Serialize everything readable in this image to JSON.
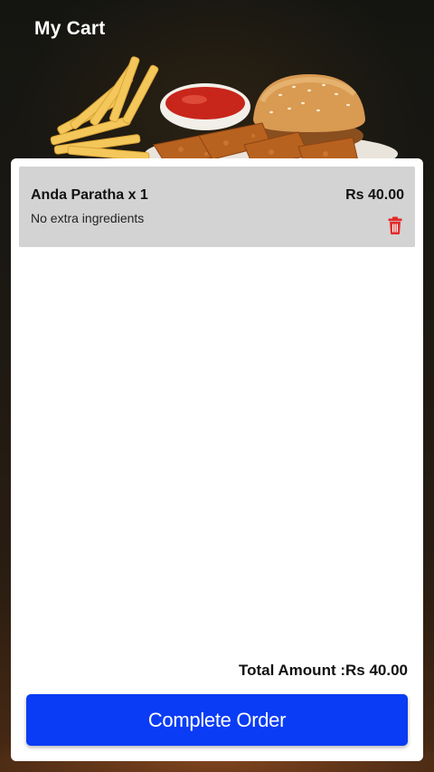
{
  "header": {
    "title": "My Cart"
  },
  "cart": {
    "items": [
      {
        "name": "Anda Paratha x 1",
        "note": "No extra ingredients",
        "price": "Rs 40.00",
        "delete_icon": "trash-icon"
      }
    ],
    "total_label": "Total Amount :Rs 40.00"
  },
  "actions": {
    "complete_label": "Complete Order"
  },
  "colors": {
    "primary_button": "#0a3cf5",
    "delete_icon": "#e32b2b",
    "item_background": "#d3d3d3",
    "panel_background": "#ffffff"
  }
}
